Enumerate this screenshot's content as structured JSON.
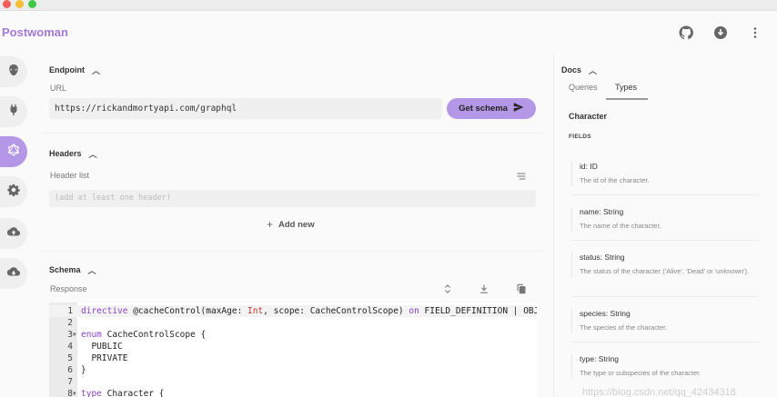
{
  "app": {
    "brand": "Postwoman"
  },
  "sidebar": {
    "items": [
      {
        "icon": "alien-icon",
        "active": false
      },
      {
        "icon": "plug-icon",
        "active": false
      },
      {
        "icon": "graphql-icon",
        "active": true
      },
      {
        "icon": "gear-icon",
        "active": false
      },
      {
        "icon": "cloud-upload-icon",
        "active": false
      },
      {
        "icon": "cloud-download-icon",
        "active": false
      }
    ]
  },
  "header_actions": [
    "github-icon",
    "download-icon",
    "more-vertical-icon"
  ],
  "endpoint": {
    "title": "Endpoint",
    "url_label": "URL",
    "url_value": "https://rickandmortyapi.com/graphql",
    "get_schema_label": "Get schema"
  },
  "headers": {
    "title": "Headers",
    "list_label": "Header list",
    "placeholder": "(add at least one header)",
    "add_new_label": "Add new"
  },
  "schema": {
    "title": "Schema",
    "response_label": "Response",
    "lines": [
      {
        "n": "1",
        "fold": "",
        "text": "directive @cacheControl(maxAge: Int, scope: CacheControlScope) on FIELD_DEFINITION | OBJECT"
      },
      {
        "n": "2",
        "fold": "",
        "text": ""
      },
      {
        "n": "3",
        "fold": "▼",
        "text": "enum CacheControlScope {"
      },
      {
        "n": "4",
        "fold": "",
        "text": "  PUBLIC"
      },
      {
        "n": "5",
        "fold": "",
        "text": "  PRIVATE"
      },
      {
        "n": "6",
        "fold": "",
        "text": "}"
      },
      {
        "n": "7",
        "fold": "",
        "text": ""
      },
      {
        "n": "8",
        "fold": "▼",
        "text": "type Character {"
      }
    ]
  },
  "docs": {
    "title": "Docs",
    "tabs": [
      "Queries",
      "Types"
    ],
    "active_tab": "Types",
    "type_name": "Character",
    "fields_label": "FIELDS",
    "fields": [
      {
        "name": "id: ID",
        "desc": "The id of the character."
      },
      {
        "name": "name: String",
        "desc": "The name of the character."
      },
      {
        "name": "status: String",
        "desc": "The status of the character ('Alive', 'Dead' or 'unknown')."
      },
      {
        "name": "species: String",
        "desc": "The species of the character."
      },
      {
        "name": "type: String",
        "desc": "The type or subspecies of the character."
      }
    ]
  },
  "watermark": "https://blog.csdn.net/qq_42434318",
  "colors": {
    "accent": "#b497e6",
    "brand": "#a57ad6"
  }
}
